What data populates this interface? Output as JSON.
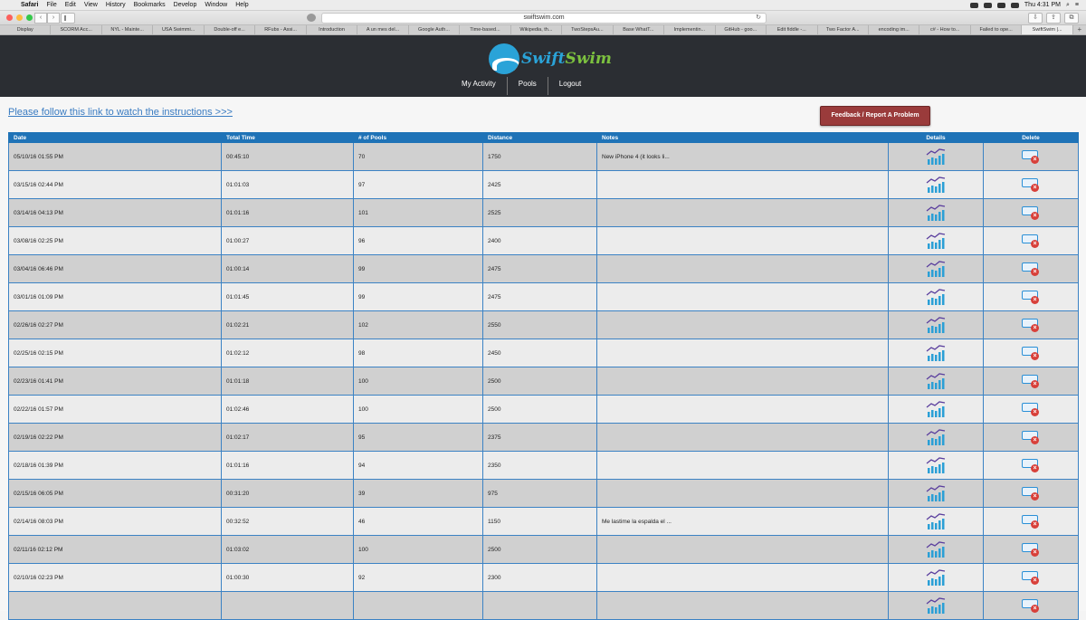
{
  "menubar": {
    "menus": [
      "Safari",
      "File",
      "Edit",
      "View",
      "History",
      "Bookmarks",
      "Develop",
      "Window",
      "Help"
    ],
    "clock": "Thu 4:31 PM"
  },
  "browser": {
    "url": "swiftswim.com",
    "tabs": [
      "Display",
      "SCORM Acc...",
      "NYL - Mainte...",
      "USA Swimmi...",
      "Double-off e...",
      "RFubs - Assi...",
      "Introduction",
      "A un mes del...",
      "Google Auth...",
      "Time-based...",
      "Wikipedia, th...",
      "TwoStepsAu...",
      "Base WhatT...",
      "Implementin...",
      "GitHub - goo...",
      "Edit fiddle -...",
      "Two Factor A...",
      "encoding im...",
      "c# - How to...",
      "Failed to ope...",
      "SwiftSwim |..."
    ]
  },
  "site": {
    "logo_part1": "Swift",
    "logo_part2": "Swim",
    "nav": [
      "My Activity",
      "Pools",
      "Logout"
    ],
    "instructions_link": "Please follow this link to watch the instructions >>>",
    "feedback_button": "Feedback / Report A Problem"
  },
  "table": {
    "headers": [
      "Date",
      "Total Time",
      "# of Pools",
      "Distance",
      "Notes",
      "Details",
      "Delete"
    ],
    "rows": [
      {
        "date": "05/10/16 01:55 PM",
        "time": "00:45:10",
        "pools": "70",
        "distance": "1750",
        "notes": "New iPhone 4 (it looks li..."
      },
      {
        "date": "03/15/16 02:44 PM",
        "time": "01:01:03",
        "pools": "97",
        "distance": "2425",
        "notes": ""
      },
      {
        "date": "03/14/16 04:13 PM",
        "time": "01:01:16",
        "pools": "101",
        "distance": "2525",
        "notes": ""
      },
      {
        "date": "03/08/16 02:25 PM",
        "time": "01:00:27",
        "pools": "96",
        "distance": "2400",
        "notes": ""
      },
      {
        "date": "03/04/16 06:46 PM",
        "time": "01:00:14",
        "pools": "99",
        "distance": "2475",
        "notes": ""
      },
      {
        "date": "03/01/16 01:09 PM",
        "time": "01:01:45",
        "pools": "99",
        "distance": "2475",
        "notes": ""
      },
      {
        "date": "02/26/16 02:27 PM",
        "time": "01:02:21",
        "pools": "102",
        "distance": "2550",
        "notes": ""
      },
      {
        "date": "02/25/16 02:15 PM",
        "time": "01:02:12",
        "pools": "98",
        "distance": "2450",
        "notes": ""
      },
      {
        "date": "02/23/16 01:41 PM",
        "time": "01:01:18",
        "pools": "100",
        "distance": "2500",
        "notes": ""
      },
      {
        "date": "02/22/16 01:57 PM",
        "time": "01:02:46",
        "pools": "100",
        "distance": "2500",
        "notes": ""
      },
      {
        "date": "02/19/16 02:22 PM",
        "time": "01:02:17",
        "pools": "95",
        "distance": "2375",
        "notes": ""
      },
      {
        "date": "02/18/16 01:39 PM",
        "time": "01:01:16",
        "pools": "94",
        "distance": "2350",
        "notes": ""
      },
      {
        "date": "02/15/16 06:05 PM",
        "time": "00:31:20",
        "pools": "39",
        "distance": "975",
        "notes": ""
      },
      {
        "date": "02/14/16 08:03 PM",
        "time": "00:32:52",
        "pools": "46",
        "distance": "1150",
        "notes": "Me lastime la espalda el ..."
      },
      {
        "date": "02/11/16 02:12 PM",
        "time": "01:03:02",
        "pools": "100",
        "distance": "2500",
        "notes": ""
      },
      {
        "date": "02/10/16 02:23 PM",
        "time": "01:00:30",
        "pools": "92",
        "distance": "2300",
        "notes": ""
      },
      {
        "date": "",
        "time": "",
        "pools": "",
        "distance": "",
        "notes": ""
      }
    ]
  },
  "colors": {
    "header_bg": "#2b2e33",
    "table_header": "#1f73b7",
    "feedback": "#9a3b3b",
    "row_gray": "#d0d0d0",
    "row_light": "#ececec"
  }
}
